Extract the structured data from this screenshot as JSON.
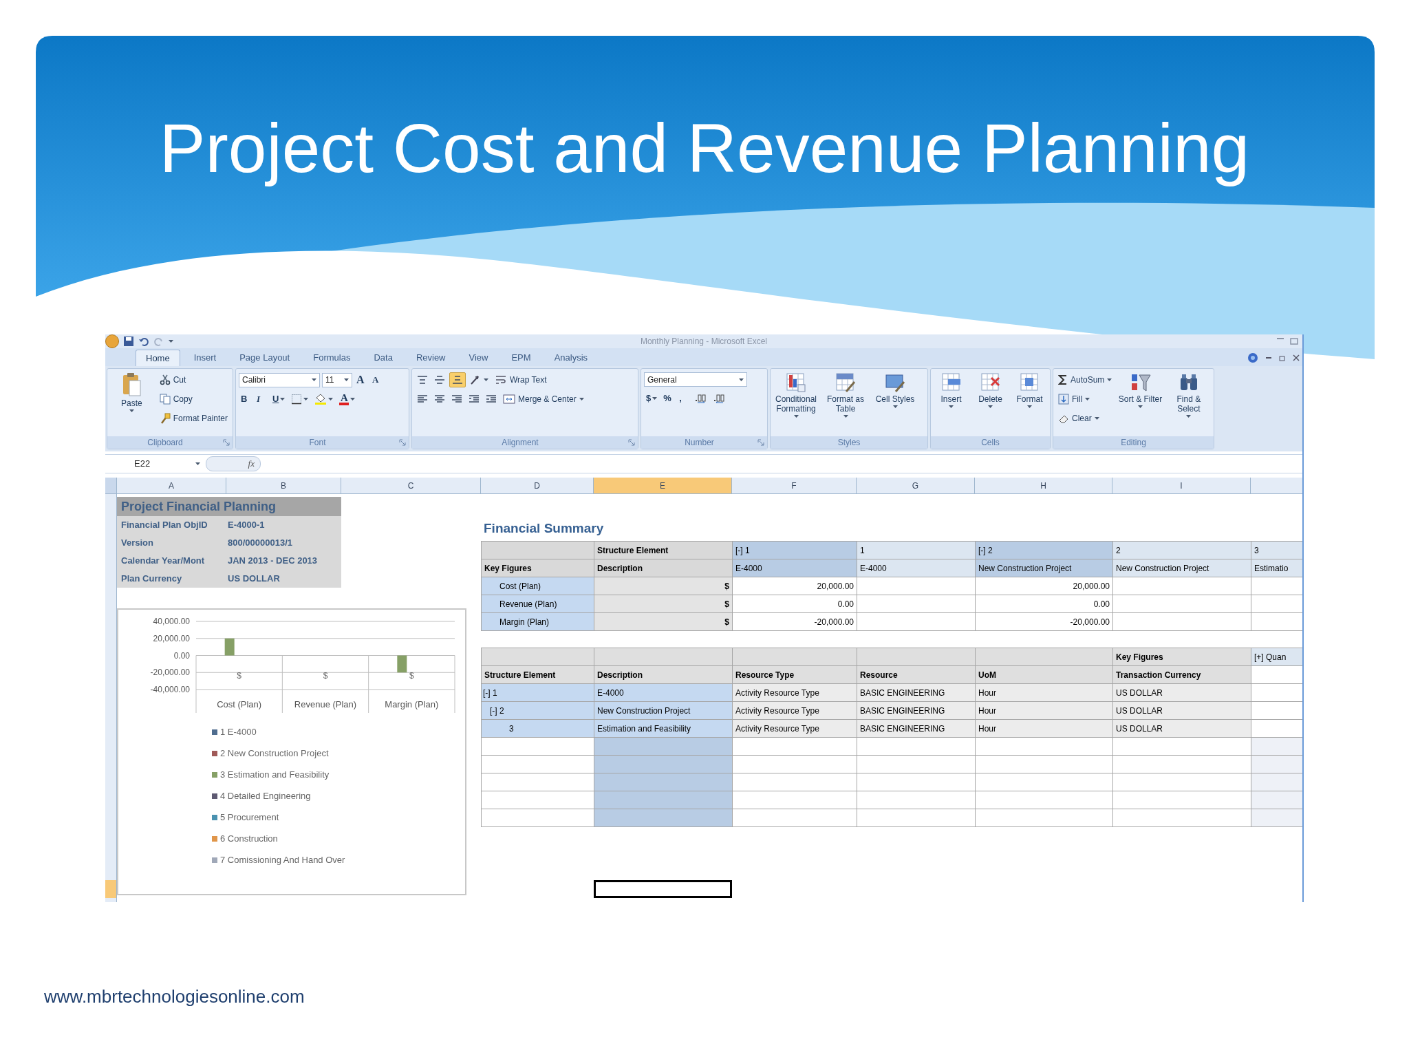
{
  "slide": {
    "title": "Project Cost and Revenue Planning",
    "footer": "www.mbrtechnologiesonline.com"
  },
  "window": {
    "title": "Monthly Planning - Microsoft Excel"
  },
  "ribbon": {
    "tabs": [
      {
        "label": "Home",
        "selected": true
      },
      {
        "label": "Insert",
        "selected": false
      },
      {
        "label": "Page Layout",
        "selected": false
      },
      {
        "label": "Formulas",
        "selected": false
      },
      {
        "label": "Data",
        "selected": false
      },
      {
        "label": "Review",
        "selected": false
      },
      {
        "label": "View",
        "selected": false
      },
      {
        "label": "EPM",
        "selected": false
      },
      {
        "label": "Analysis",
        "selected": false
      }
    ],
    "groups": [
      {
        "label": "Clipboard",
        "launcher": true,
        "items": [
          {
            "kind": "large",
            "label": "Paste",
            "dropdown": true
          },
          {
            "kind": "stack",
            "lines": [
              [
                {
                  "kind": "small",
                  "label": "Cut",
                  "dropdown": false
                }
              ],
              [
                {
                  "kind": "small",
                  "label": "Copy",
                  "dropdown": false
                }
              ],
              [
                {
                  "kind": "small",
                  "label": "Format Painter",
                  "dropdown": false
                }
              ]
            ]
          }
        ]
      },
      {
        "label": "Font",
        "launcher": true,
        "items": [
          {
            "kind": "stack",
            "lines": [
              [
                {
                  "kind": "combo",
                  "value": "Calibri"
                },
                {
                  "kind": "combo",
                  "value": "11"
                },
                {
                  "kind": "glyph",
                  "label": "A",
                  "dropdown": false
                },
                {
                  "kind": "glyph",
                  "label": "A",
                  "dropdown": false
                }
              ],
              [
                {
                  "kind": "glyph",
                  "label": "B",
                  "dropdown": false
                },
                {
                  "kind": "glyph",
                  "label": "I",
                  "dropdown": false
                },
                {
                  "kind": "glyph",
                  "label": "U",
                  "dropdown": true
                },
                {
                  "kind": "icon",
                  "dropdown": true
                },
                {
                  "kind": "icon",
                  "dropdown": true
                },
                {
                  "kind": "color-glyph",
                  "label": "A",
                  "dropdown": true
                }
              ]
            ]
          }
        ]
      },
      {
        "label": "Alignment",
        "launcher": true,
        "items": [
          {
            "kind": "stack",
            "lines": [
              [
                {
                  "kind": "icon",
                  "dropdown": false,
                  "selected": false
                },
                {
                  "kind": "icon",
                  "dropdown": false,
                  "selected": false
                },
                {
                  "kind": "icon",
                  "dropdown": false,
                  "selected": true
                },
                {
                  "kind": "icon",
                  "dropdown": true,
                  "selected": false
                },
                {
                  "kind": "small",
                  "label": "Wrap Text",
                  "dropdown": false,
                  "selected": false
                }
              ],
              [
                {
                  "kind": "icon",
                  "dropdown": false
                },
                {
                  "kind": "icon",
                  "dropdown": false
                },
                {
                  "kind": "icon",
                  "dropdown": false
                },
                {
                  "kind": "icon",
                  "dropdown": false
                },
                {
                  "kind": "icon",
                  "dropdown": false
                },
                {
                  "kind": "small",
                  "label": "Merge & Center",
                  "dropdown": true
                }
              ]
            ]
          }
        ]
      },
      {
        "label": "Number",
        "launcher": true,
        "items": [
          {
            "kind": "stack",
            "lines": [
              [
                {
                  "kind": "combo",
                  "value": "General"
                }
              ],
              [
                {
                  "kind": "glyph",
                  "label": "$",
                  "dropdown": true
                },
                {
                  "kind": "glyph",
                  "label": "%",
                  "dropdown": false
                },
                {
                  "kind": "glyph",
                  "label": ",",
                  "dropdown": false
                },
                {
                  "kind": "icon",
                  "dropdown": false
                },
                {
                  "kind": "icon",
                  "dropdown": false
                }
              ]
            ]
          }
        ]
      },
      {
        "label": "Styles",
        "launcher": false,
        "items": [
          {
            "kind": "large",
            "label": "Conditional Formatting",
            "dropdown": true
          },
          {
            "kind": "large",
            "label": "Format as Table",
            "dropdown": true
          },
          {
            "kind": "large",
            "label": "Cell Styles",
            "dropdown": true
          }
        ]
      },
      {
        "label": "Cells",
        "launcher": false,
        "items": [
          {
            "kind": "large",
            "label": "Insert",
            "dropdown": true
          },
          {
            "kind": "large",
            "label": "Delete",
            "dropdown": true
          },
          {
            "kind": "large",
            "label": "Format",
            "dropdown": true
          }
        ]
      },
      {
        "label": "Editing",
        "launcher": false,
        "items": [
          {
            "kind": "stack",
            "lines": [
              [
                {
                  "kind": "small",
                  "label": "AutoSum",
                  "dropdown": true
                }
              ],
              [
                {
                  "kind": "small",
                  "label": "Fill",
                  "dropdown": true
                }
              ],
              [
                {
                  "kind": "small",
                  "label": "Clear",
                  "dropdown": true
                }
              ]
            ]
          },
          {
            "kind": "large",
            "label": "Sort & Filter",
            "dropdown": true
          },
          {
            "kind": "large",
            "label": "Find & Select",
            "dropdown": true
          }
        ]
      }
    ]
  },
  "formula_bar": {
    "name_box": "E22",
    "function_button": "fx"
  },
  "columns": [
    {
      "label": "A",
      "selected": false
    },
    {
      "label": "B",
      "selected": false
    },
    {
      "label": "C",
      "selected": false
    },
    {
      "label": "D",
      "selected": false
    },
    {
      "label": "E",
      "selected": true
    },
    {
      "label": "F",
      "selected": false
    },
    {
      "label": "G",
      "selected": false
    },
    {
      "label": "H",
      "selected": false
    },
    {
      "label": "I",
      "selected": false
    }
  ],
  "sheet": {
    "info_block": {
      "title": "Project Financial Planning",
      "rows": [
        {
          "label": "Financial Plan ObjID",
          "value": "E-4000-1"
        },
        {
          "label": "Version",
          "value": "800/00000013/1"
        },
        {
          "label": "Calendar Year/Mont",
          "value": "JAN 2013 - DEC 2013"
        },
        {
          "label": "Plan Currency",
          "value": "US DOLLAR"
        }
      ]
    },
    "chart": {
      "category_units": [
        "$",
        "$",
        "$"
      ],
      "chart_data": {
        "type": "bar",
        "grid": true,
        "categories": [
          "Cost (Plan)",
          "Revenue (Plan)",
          "Margin (Plan)"
        ],
        "ylim": [
          -40000,
          40000
        ],
        "yticks": [
          {
            "value": 40000,
            "label": "40,000.00"
          },
          {
            "value": 20000,
            "label": "20,000.00"
          },
          {
            "value": 0,
            "label": "0.00"
          },
          {
            "value": -20000,
            "label": "-20,000.00"
          },
          {
            "value": -40000,
            "label": "-40,000.00"
          }
        ],
        "series": [
          {
            "name": "1 E-4000",
            "color": "#4f6d8f",
            "values": [
              null,
              null,
              null
            ]
          },
          {
            "name": "2 New Construction Project",
            "color": "#a05a58",
            "values": [
              null,
              null,
              null
            ]
          },
          {
            "name": "3 Estimation and Feasibility",
            "color": "#86a066",
            "values": [
              20000,
              0,
              -20000
            ]
          },
          {
            "name": "4 Detailed Engineering",
            "color": "#5e5a72",
            "values": [
              null,
              null,
              null
            ]
          },
          {
            "name": "5 Procurement",
            "color": "#4a92b0",
            "values": [
              null,
              null,
              null
            ]
          },
          {
            "name": "6 Construction",
            "color": "#e0964a",
            "values": [
              null,
              null,
              null
            ]
          },
          {
            "name": "7 Comissioning And Hand Over",
            "color": "#a0a8b8",
            "values": [
              null,
              null,
              null
            ]
          }
        ]
      }
    },
    "financial_summary": {
      "title": "Financial Summary",
      "header_rows": [
        [
          null,
          "Structure Element",
          "[-] 1",
          "1",
          "[-] 2",
          "2",
          "3"
        ],
        [
          "Key Figures",
          "Description",
          "E-4000",
          "E-4000",
          "New Construction Project",
          "New Construction Project",
          "Estimatio"
        ]
      ],
      "rows": [
        [
          "Cost (Plan)",
          "$",
          "20,000.00",
          null,
          "20,000.00",
          null,
          null
        ],
        [
          "Revenue (Plan)",
          "$",
          "0.00",
          null,
          "0.00",
          null,
          null
        ],
        [
          "Margin (Plan)",
          "$",
          "-20,000.00",
          null,
          "-20,000.00",
          null,
          null
        ]
      ]
    },
    "resource_table": {
      "header_rows": [
        [
          null,
          null,
          null,
          null,
          null,
          "Key Figures",
          "[+] Quan"
        ],
        [
          "Structure Element",
          "Description",
          "Resource Type",
          "Resource",
          "UoM",
          "Transaction Currency",
          null
        ]
      ],
      "rows": [
        {
          "element": "[-] 1",
          "cells": [
            "E-4000",
            "Activity Resource Type",
            "BASIC ENGINEERING",
            "Hour",
            "US DOLLAR"
          ],
          "children": [
            {
              "element": "[-] 2",
              "cells": [
                "New Construction Project",
                "Activity Resource Type",
                "BASIC ENGINEERING",
                "Hour",
                "US DOLLAR"
              ],
              "children": [
                {
                  "element": "3",
                  "cells": [
                    "Estimation and Feasibility",
                    "Activity Resource Type",
                    "BASIC ENGINEERING",
                    "Hour",
                    "US DOLLAR"
                  ]
                }
              ]
            }
          ]
        }
      ]
    }
  }
}
